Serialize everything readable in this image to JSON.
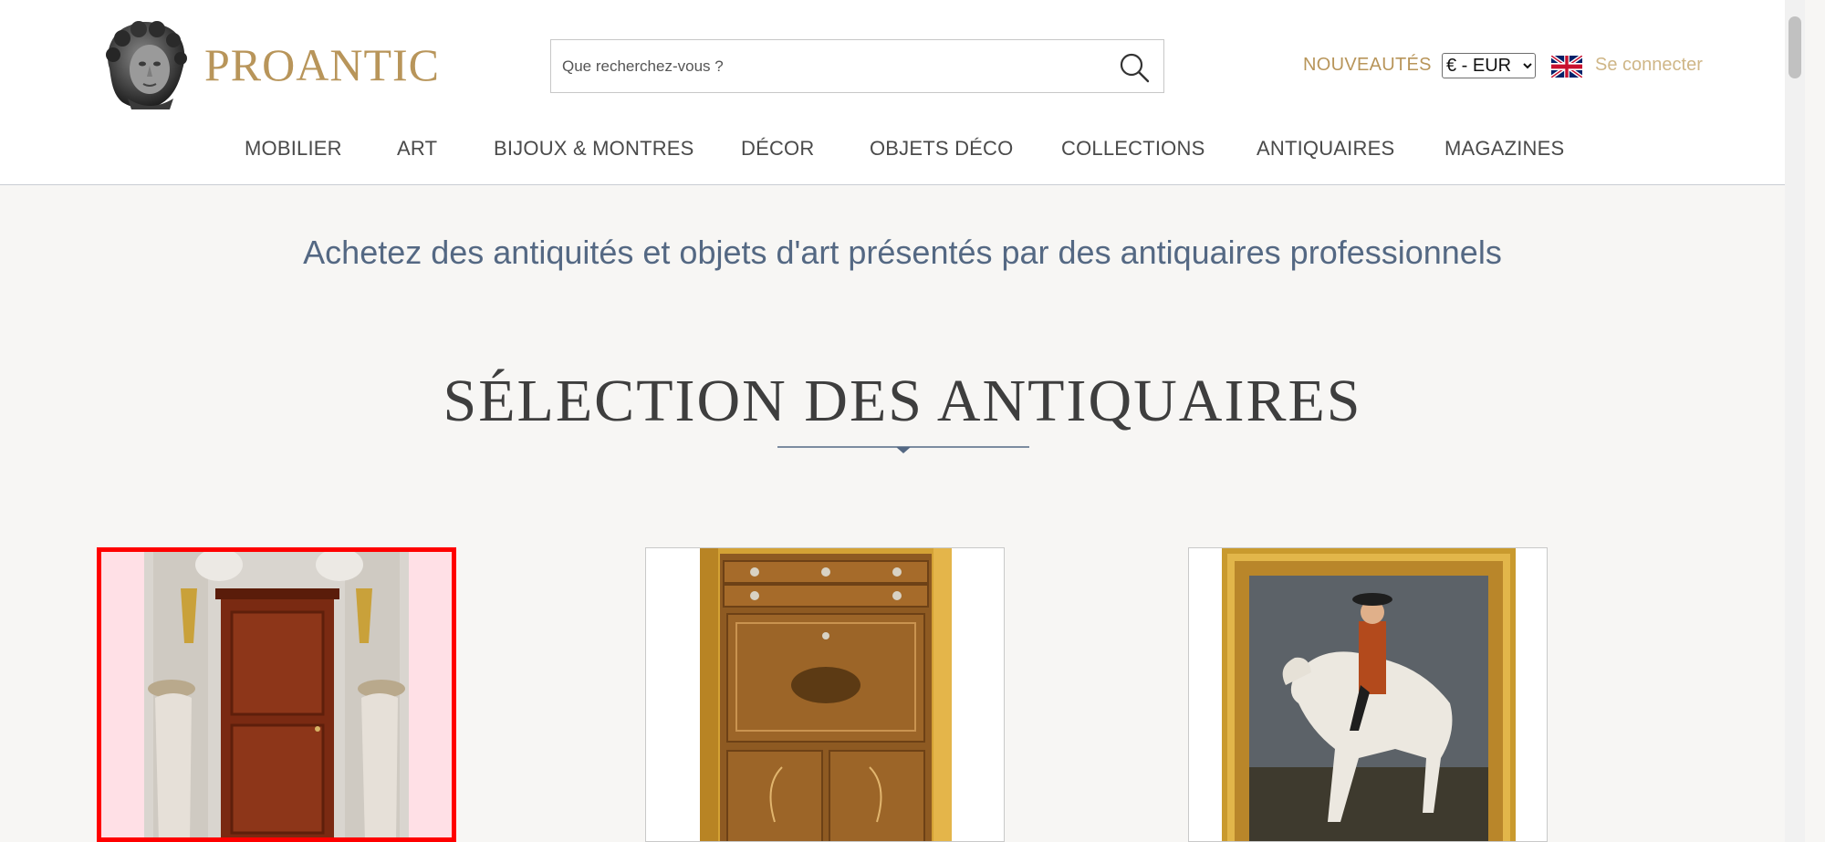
{
  "brand": {
    "name": "PROANTIC",
    "logo_icon": "bust-icon"
  },
  "search": {
    "placeholder": "Que recherchez-vous ?",
    "icon": "search-icon"
  },
  "header_links": {
    "new": "NOUVEAUTÉS",
    "currency_selected": "€ - EUR",
    "language_icon": "uk-flag-icon",
    "login": "Se connecter"
  },
  "nav": {
    "items": [
      {
        "label": "MOBILIER"
      },
      {
        "label": "ART"
      },
      {
        "label": "BIJOUX & MONTRES"
      },
      {
        "label": "DÉCOR"
      },
      {
        "label": "OBJETS DÉCO"
      },
      {
        "label": "COLLECTIONS"
      },
      {
        "label": "ANTIQUAIRES"
      },
      {
        "label": "MAGAZINES"
      }
    ]
  },
  "main": {
    "tagline": "Achetez des antiquités et objets d'art présentés par des antiquaires professionnels",
    "section_title": "SÉLECTION DES ANTIQUAIRES",
    "cards": [
      {
        "image": "mahogany-cabinet-image",
        "selected": true
      },
      {
        "image": "marquetry-secretary-image",
        "selected": false
      },
      {
        "image": "equestrian-portrait-image",
        "selected": false
      }
    ]
  },
  "colors": {
    "brand_gold": "#b8955a",
    "login_gold": "#cfb687",
    "tagline_blue": "#546883",
    "background": "#f7f6f4",
    "selection_red": "#ff0000"
  }
}
